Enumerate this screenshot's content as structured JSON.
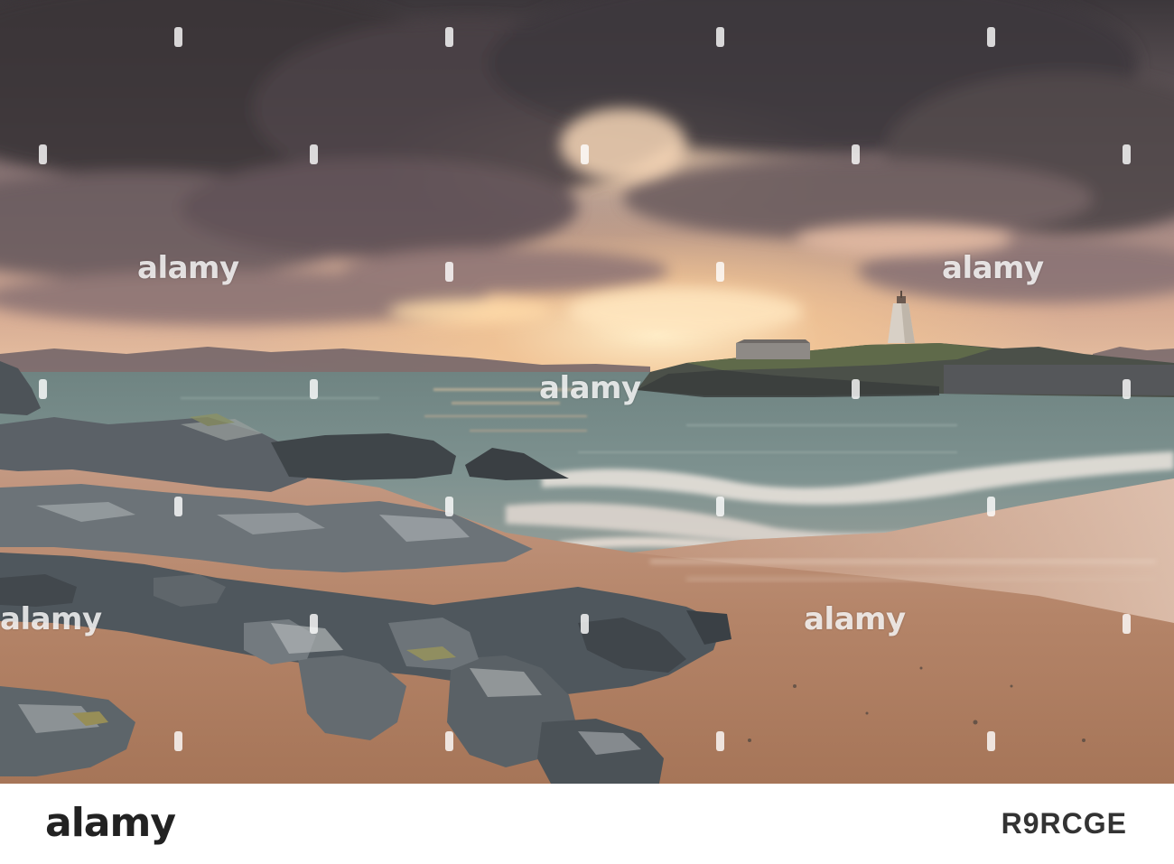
{
  "watermark": {
    "brand": "alamy"
  },
  "footer": {
    "logo": "alamy",
    "image_id": "R9RCGE"
  },
  "palette": {
    "cloud_dark": "#3f3a3f",
    "cloud_mid": "#7a6b6e",
    "sky_glow": "#f6cf9c",
    "sea": "#6f8c8c",
    "sand": "#b78a70",
    "rock": "#4f5a60"
  }
}
